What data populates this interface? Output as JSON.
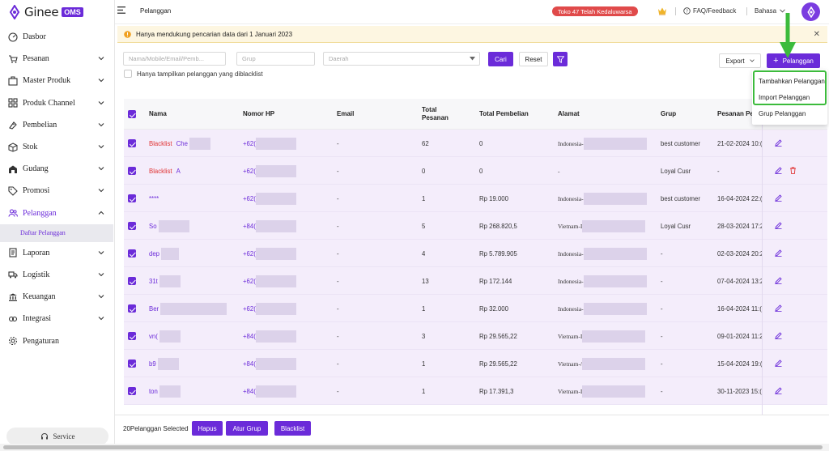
{
  "brand": {
    "name": "Ginee",
    "badge": "OMS"
  },
  "sidebar": {
    "items": [
      {
        "label": "Dasbor",
        "icon": "dashboard-icon",
        "chevron": false
      },
      {
        "label": "Pesanan",
        "icon": "cart-icon",
        "chevron": true
      },
      {
        "label": "Master Produk",
        "icon": "product-icon",
        "chevron": true
      },
      {
        "label": "Produk Channel",
        "icon": "channel-icon",
        "chevron": true
      },
      {
        "label": "Pembelian",
        "icon": "purchase-icon",
        "chevron": true
      },
      {
        "label": "Stok",
        "icon": "box-icon",
        "chevron": true
      },
      {
        "label": "Gudang",
        "icon": "warehouse-icon",
        "chevron": true
      },
      {
        "label": "Promosi",
        "icon": "tag-icon",
        "chevron": true
      },
      {
        "label": "Pelanggan",
        "icon": "users-icon",
        "chevron": true,
        "active": true
      }
    ],
    "sub_active": "Daftar Pelanggan",
    "items2": [
      {
        "label": "Laporan",
        "icon": "report-icon",
        "chevron": true
      },
      {
        "label": "Logistik",
        "icon": "truck-icon",
        "chevron": true
      },
      {
        "label": "Keuangan",
        "icon": "finance-icon",
        "chevron": true
      },
      {
        "label": "Integrasi",
        "icon": "integration-icon",
        "chevron": true
      },
      {
        "label": "Pengaturan",
        "icon": "gear-icon",
        "chevron": false
      }
    ],
    "service": "Service"
  },
  "topbar": {
    "page": "Pelanggan",
    "expired": "Toko 47 Telah Kedaluwarsa",
    "faq": "FAQ/Feedback",
    "language": "Bahasa"
  },
  "notice": "Hanya mendukung pencarian data dari 1 Januari 2023",
  "filters": {
    "search_placeholder": "Nama/Mobile/Email/Pemb...",
    "group_placeholder": "Grup",
    "region_placeholder": "Daerah",
    "search_btn": "Cari",
    "reset_btn": "Reset",
    "blacklist_only": "Hanya tampilkan pelanggan yang diblacklist",
    "export_btn": "Export",
    "add_btn": "Pelanggan"
  },
  "dropdown": [
    "Tambahkan Pelanggan",
    "Import Pelanggan",
    "Grup Pelanggan"
  ],
  "table": {
    "headers": {
      "name": "Nama",
      "phone": "Nomor HP",
      "email": "Email",
      "orders1": "Total",
      "orders2": "Pesanan",
      "total": "Total Pembelian",
      "address": "Alamat",
      "group": "Grup",
      "last": "Pesanan Pe"
    },
    "rows": [
      {
        "tag": "Blacklist",
        "name": "Che",
        "phone": "+62(",
        "email": "-",
        "orders": "62",
        "total": "0",
        "address": "Indonesia-",
        "group": "best customer",
        "date": "21-02-2024 10:(",
        "delete": false
      },
      {
        "tag": "Blacklist",
        "name": "A",
        "phone": "+62(",
        "email": "-",
        "orders": "0",
        "total": "0",
        "address": "-",
        "group": "Loyal Cusr",
        "date": "-",
        "delete": true
      },
      {
        "tag": "",
        "name": "****",
        "phone": "+62(",
        "email": "-",
        "orders": "1",
        "total": "Rp 19.000",
        "address": "Indonesia-",
        "group": "best customer",
        "date": "16-04-2024 22:(",
        "delete": false
      },
      {
        "tag": "",
        "name": "So",
        "phone": "+84(",
        "email": "-",
        "orders": "5",
        "total": "Rp 268.820,5",
        "address": "Vietnam-I",
        "group": "Loyal Cusr",
        "date": "28-03-2024 17:2",
        "delete": false
      },
      {
        "tag": "",
        "name": "dep",
        "phone": "+62(",
        "email": "-",
        "orders": "4",
        "total": "Rp 5.789.905",
        "address": "Indonesia-",
        "group": "-",
        "date": "02-03-2024 20:2",
        "delete": false
      },
      {
        "tag": "",
        "name": "31t",
        "phone": "+62(",
        "email": "-",
        "orders": "13",
        "total": "Rp 172.144",
        "address": "Indonesia-",
        "group": "-",
        "date": "07-04-2024 13:2",
        "delete": false
      },
      {
        "tag": "",
        "name": "Ber",
        "phone": "+62(",
        "email": "-",
        "orders": "1",
        "total": "Rp 32.000",
        "address": "Indonesia-",
        "group": "-",
        "date": "16-04-2024 11:(",
        "delete": false
      },
      {
        "tag": "",
        "name": "vn(",
        "phone": "+84(",
        "email": "-",
        "orders": "3",
        "total": "Rp 29.565,22",
        "address": "Vietnam-I",
        "group": "-",
        "date": "09-01-2024 11:2",
        "delete": false
      },
      {
        "tag": "",
        "name": "b9",
        "phone": "+84(",
        "email": "-",
        "orders": "1",
        "total": "Rp 29.565,22",
        "address": "Vietnam-/",
        "group": "-",
        "date": "15-04-2024 19:(",
        "delete": false
      },
      {
        "tag": "",
        "name": "ton",
        "phone": "+84(",
        "email": "-",
        "orders": "1",
        "total": "Rp 17.391,3",
        "address": "Vietnam-I",
        "group": "-",
        "date": "30-11-2023 15:(",
        "delete": false
      }
    ]
  },
  "footer": {
    "selected": "20Pelanggan Selected",
    "delete": "Hapus",
    "group": "Atur Grup",
    "blacklist": "Blacklist"
  },
  "colors": {
    "accent": "#6b2bd9",
    "danger": "#e04a4a",
    "highlight": "#3cbb3c"
  }
}
